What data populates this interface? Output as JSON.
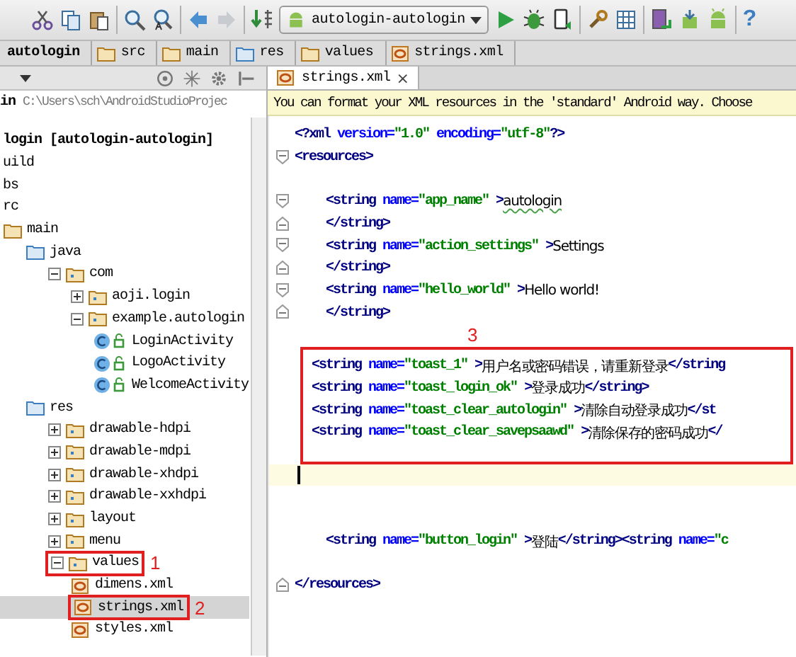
{
  "toolbar": {
    "items": [
      {
        "kind": "cut"
      },
      {
        "kind": "copy"
      },
      {
        "kind": "paste"
      },
      {
        "kind": "separator"
      },
      {
        "kind": "find"
      },
      {
        "kind": "replace"
      },
      {
        "kind": "separator"
      },
      {
        "kind": "back"
      },
      {
        "kind": "forward"
      },
      {
        "kind": "separator"
      },
      {
        "kind": "make"
      },
      {
        "kind": "config",
        "label": "autologin-autologin"
      },
      {
        "kind": "run"
      },
      {
        "kind": "debug"
      },
      {
        "kind": "device"
      },
      {
        "kind": "separator"
      },
      {
        "kind": "wrench"
      },
      {
        "kind": "structure"
      },
      {
        "kind": "separator"
      },
      {
        "kind": "avd"
      },
      {
        "kind": "sdk"
      },
      {
        "kind": "android"
      },
      {
        "kind": "separator"
      },
      {
        "kind": "help",
        "label": "?"
      }
    ]
  },
  "breadcrumbs": [
    {
      "label": "autologin",
      "kind": "module"
    },
    {
      "label": "src",
      "kind": "folder"
    },
    {
      "label": "main",
      "kind": "folder"
    },
    {
      "label": "res",
      "kind": "res-folder"
    },
    {
      "label": "values",
      "kind": "folder"
    },
    {
      "label": "strings.xml",
      "kind": "xml"
    }
  ],
  "project_panel": {
    "header_icons": [
      {
        "kind": "target"
      },
      {
        "kind": "collapse"
      },
      {
        "kind": "gear"
      },
      {
        "kind": "pin"
      }
    ],
    "root": {
      "name": "in",
      "path": "C:\\Users\\sch\\AndroidStudioProjec"
    },
    "tree": [
      {
        "label": "login [autologin-autologin]",
        "kind": "module",
        "selected": false,
        "children": [
          {
            "label": "uild",
            "selected": false
          },
          {
            "label": "bs",
            "selected": false
          },
          {
            "label": "rc",
            "selected": false,
            "children": [
              {
                "label": "main",
                "kind": "folder",
                "selected": false,
                "children": [
                  {
                    "label": "java",
                    "kind": "source-folder",
                    "selected": false,
                    "children": [
                      {
                        "label": "com",
                        "kind": "package",
                        "expanded": true,
                        "selected": false,
                        "children": [
                          {
                            "label": "aoji.login",
                            "kind": "package",
                            "expanded": false,
                            "selected": false
                          },
                          {
                            "label": "example.autologin",
                            "kind": "package",
                            "expanded": true,
                            "selected": false,
                            "children": [
                              {
                                "label": "LoginActivity",
                                "kind": "class",
                                "selected": false
                              },
                              {
                                "label": "LogoActivity",
                                "kind": "class",
                                "selected": false
                              },
                              {
                                "label": "WelcomeActivity",
                                "kind": "class",
                                "selected": false
                              }
                            ]
                          }
                        ]
                      }
                    ]
                  },
                  {
                    "label": "res",
                    "kind": "source-folder",
                    "selected": false,
                    "children": [
                      {
                        "label": "drawable-hdpi",
                        "kind": "package",
                        "expanded": false,
                        "selected": false
                      },
                      {
                        "label": "drawable-mdpi",
                        "kind": "package",
                        "expanded": false,
                        "selected": false
                      },
                      {
                        "label": "drawable-xhdpi",
                        "kind": "package",
                        "expanded": false,
                        "selected": false
                      },
                      {
                        "label": "drawable-xxhdpi",
                        "kind": "package",
                        "expanded": false,
                        "selected": false
                      },
                      {
                        "label": "layout",
                        "kind": "package",
                        "expanded": false,
                        "selected": false
                      },
                      {
                        "label": "menu",
                        "kind": "package",
                        "expanded": false,
                        "selected": false
                      },
                      {
                        "label": "values",
                        "kind": "package",
                        "expanded": true,
                        "selected": false,
                        "annotation": "1",
                        "children": [
                          {
                            "label": "dimens.xml",
                            "kind": "xml",
                            "selected": false
                          },
                          {
                            "label": "strings.xml",
                            "kind": "xml",
                            "selected": true,
                            "annotation": "2"
                          },
                          {
                            "label": "styles.xml",
                            "kind": "xml",
                            "selected": false
                          }
                        ]
                      }
                    ]
                  }
                ]
              }
            ]
          }
        ]
      }
    ]
  },
  "editor": {
    "tab": {
      "label": "strings.xml",
      "close": "×"
    },
    "notice": "You can format your XML resources in the 'standard' Android way. Choose",
    "lines": [
      {
        "kind": "code",
        "fold_start": false,
        "fold_end": false,
        "indented": false,
        "current": false,
        "tokens": [
          {
            "kind": "tag",
            "text": "<?xml "
          },
          {
            "kind": "attr",
            "text": "version="
          },
          {
            "kind": "value",
            "text": "\"1.0\" "
          },
          {
            "kind": "attr",
            "text": "encoding="
          },
          {
            "kind": "value",
            "text": "\"utf-8\""
          },
          {
            "kind": "tag",
            "text": "?>"
          }
        ]
      },
      {
        "kind": "code",
        "fold_start": true,
        "fold_end": false,
        "indented": false,
        "current": false,
        "tokens": [
          {
            "kind": "tag",
            "text": "<resources>"
          }
        ]
      },
      {
        "kind": "blank",
        "current": false
      },
      {
        "kind": "code",
        "fold_start": true,
        "fold_end": false,
        "indented": true,
        "current": false,
        "tokens": [
          {
            "kind": "tag",
            "text": "<string "
          },
          {
            "kind": "attr",
            "text": "name="
          },
          {
            "kind": "value",
            "text": "\"app_name\" "
          },
          {
            "kind": "tag",
            "text": ">"
          },
          {
            "kind": "text",
            "text": "autologin",
            "typo": true
          }
        ]
      },
      {
        "kind": "code",
        "fold_start": false,
        "fold_end": true,
        "indented": true,
        "current": false,
        "tokens": [
          {
            "kind": "tag",
            "text": "</string>"
          }
        ]
      },
      {
        "kind": "code",
        "fold_start": true,
        "fold_end": false,
        "indented": true,
        "current": false,
        "tokens": [
          {
            "kind": "tag",
            "text": "<string "
          },
          {
            "kind": "attr",
            "text": "name="
          },
          {
            "kind": "value",
            "text": "\"action_settings\" "
          },
          {
            "kind": "tag",
            "text": ">"
          },
          {
            "kind": "text",
            "text": "Settings"
          }
        ]
      },
      {
        "kind": "code",
        "fold_start": false,
        "fold_end": true,
        "indented": true,
        "current": false,
        "tokens": [
          {
            "kind": "tag",
            "text": "</string>"
          }
        ]
      },
      {
        "kind": "code",
        "fold_start": true,
        "fold_end": false,
        "indented": true,
        "current": false,
        "tokens": [
          {
            "kind": "tag",
            "text": "<string "
          },
          {
            "kind": "attr",
            "text": "name="
          },
          {
            "kind": "value",
            "text": "\"hello_world\" "
          },
          {
            "kind": "tag",
            "text": ">"
          },
          {
            "kind": "text",
            "text": "Hello world!"
          }
        ]
      },
      {
        "kind": "code",
        "fold_start": false,
        "fold_end": true,
        "indented": true,
        "current": false,
        "tokens": [
          {
            "kind": "tag",
            "text": "</string>"
          }
        ]
      },
      {
        "kind": "group",
        "annotation": "3",
        "lines": [
          {
            "kind": "code",
            "indented": false,
            "current": false,
            "tokens": [
              {
                "kind": "tag",
                "text": "<string "
              },
              {
                "kind": "attr",
                "text": "name="
              },
              {
                "kind": "value",
                "text": "\"toast_1\" "
              },
              {
                "kind": "tag",
                "text": ">"
              },
              {
                "kind": "text",
                "text": "用户名或密码错误，请重新登录"
              },
              {
                "kind": "tag",
                "text": "</string"
              }
            ]
          },
          {
            "kind": "code",
            "indented": false,
            "current": false,
            "tokens": [
              {
                "kind": "tag",
                "text": "<string "
              },
              {
                "kind": "attr",
                "text": "name="
              },
              {
                "kind": "value",
                "text": "\"toast_login_ok\" "
              },
              {
                "kind": "tag",
                "text": ">"
              },
              {
                "kind": "text",
                "text": "登录成功"
              },
              {
                "kind": "tag",
                "text": "</string>"
              }
            ]
          },
          {
            "kind": "code",
            "indented": false,
            "current": false,
            "tokens": [
              {
                "kind": "tag",
                "text": "<string "
              },
              {
                "kind": "attr",
                "text": "name="
              },
              {
                "kind": "value",
                "text": "\"toast_clear_autologin\" "
              },
              {
                "kind": "tag",
                "text": ">"
              },
              {
                "kind": "text",
                "text": "清除自动登录成功"
              },
              {
                "kind": "tag",
                "text": "</st"
              }
            ]
          },
          {
            "kind": "code",
            "indented": false,
            "current": false,
            "tokens": [
              {
                "kind": "tag",
                "text": "<string "
              },
              {
                "kind": "attr",
                "text": "name="
              },
              {
                "kind": "value",
                "text": "\"toast_clear_savepsaawd\" "
              },
              {
                "kind": "tag",
                "text": ">"
              },
              {
                "kind": "text",
                "text": "清除保存的密码成功"
              },
              {
                "kind": "tag",
                "text": "</"
              }
            ]
          }
        ]
      },
      {
        "kind": "blank",
        "current": true
      },
      {
        "kind": "blank",
        "current": false
      },
      {
        "kind": "blank",
        "current": false
      },
      {
        "kind": "code",
        "fold_start": false,
        "fold_end": false,
        "indented": true,
        "current": false,
        "tokens": [
          {
            "kind": "tag",
            "text": "<string "
          },
          {
            "kind": "attr",
            "text": "name="
          },
          {
            "kind": "value",
            "text": "\"button_login\" "
          },
          {
            "kind": "tag",
            "text": ">"
          },
          {
            "kind": "text",
            "text": "登陆"
          },
          {
            "kind": "tag",
            "text": "</string><string "
          },
          {
            "kind": "attr",
            "text": "name="
          },
          {
            "kind": "value",
            "text": "\"c"
          }
        ]
      },
      {
        "kind": "blank",
        "current": false
      },
      {
        "kind": "code",
        "fold_start": false,
        "fold_end": true,
        "indented": false,
        "current": false,
        "tokens": [
          {
            "kind": "tag",
            "text": "</resources>"
          }
        ]
      }
    ]
  }
}
